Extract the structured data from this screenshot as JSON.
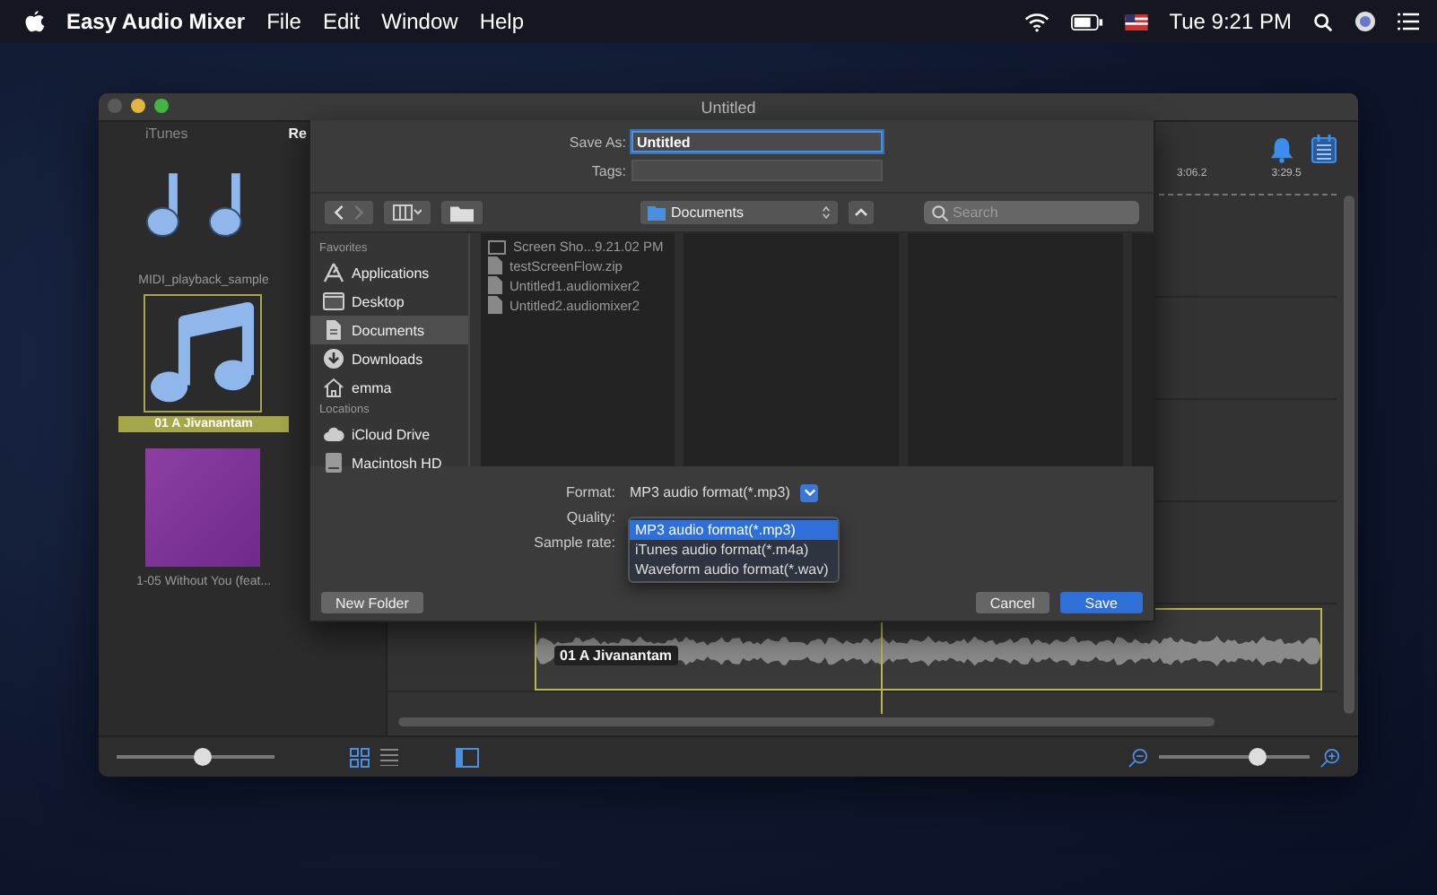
{
  "menu_bar": {
    "app_name": "Easy Audio Mixer",
    "menus": [
      "File",
      "Edit",
      "Window",
      "Help"
    ],
    "clock": "Tue 9:21 PM"
  },
  "window": {
    "title": "Untitled"
  },
  "library": {
    "tabs": [
      {
        "label": "iTunes",
        "selected": false
      },
      {
        "label": "Re",
        "selected": true
      }
    ],
    "items": [
      {
        "title": "MIDI_playback_sample",
        "kind": "notes",
        "selected": false
      },
      {
        "title": "01 A Jivanantam",
        "kind": "note",
        "selected": true
      },
      {
        "title": "1-05 Without You (feat...",
        "kind": "album",
        "selected": false
      }
    ],
    "size_slider": {
      "level": 0.55
    }
  },
  "timeline": {
    "ticks": [
      "3:06.2",
      "3:29.5"
    ],
    "clip_title": "01 A Jivanantam",
    "zoom_slider": {
      "level": 0.65
    }
  },
  "save_sheet": {
    "save_as_label": "Save As:",
    "save_as_value": "Untitled",
    "tags_label": "Tags:",
    "location": "Documents",
    "search_placeholder": "Search",
    "sidebar": [
      {
        "heading": "Favorites",
        "items": [
          {
            "label": "Applications",
            "kind": "apps",
            "selected": false
          },
          {
            "label": "Desktop",
            "kind": "desktop",
            "selected": false
          },
          {
            "label": "Documents",
            "kind": "documents",
            "selected": true
          },
          {
            "label": "Downloads",
            "kind": "downloads",
            "selected": false
          },
          {
            "label": "emma",
            "kind": "home",
            "selected": false
          }
        ]
      },
      {
        "heading": "Locations",
        "items": [
          {
            "label": "iCloud Drive",
            "kind": "cloud",
            "selected": false
          },
          {
            "label": "Macintosh HD",
            "kind": "disk",
            "selected": false
          }
        ]
      }
    ],
    "files": [
      {
        "name": "Screen Sho...9.21.02 PM",
        "kind": "screenshot"
      },
      {
        "name": "testScreenFlow.zip",
        "kind": "file"
      },
      {
        "name": "Untitled1.audiomixer2",
        "kind": "file"
      },
      {
        "name": "Untitled2.audiomixer2",
        "kind": "file"
      }
    ],
    "format_label": "Format:",
    "format_value": "MP3 audio format(*.mp3)",
    "quality_label": "Quality:",
    "sample_rate_label": "Sample rate:",
    "format_options": [
      {
        "label": "MP3 audio format(*.mp3)",
        "selected": true
      },
      {
        "label": "iTunes audio format(*.m4a)",
        "selected": false
      },
      {
        "label": "Waveform audio format(*.wav)",
        "selected": false
      }
    ],
    "new_folder_button": "New Folder",
    "cancel_button": "Cancel",
    "save_button": "Save"
  }
}
